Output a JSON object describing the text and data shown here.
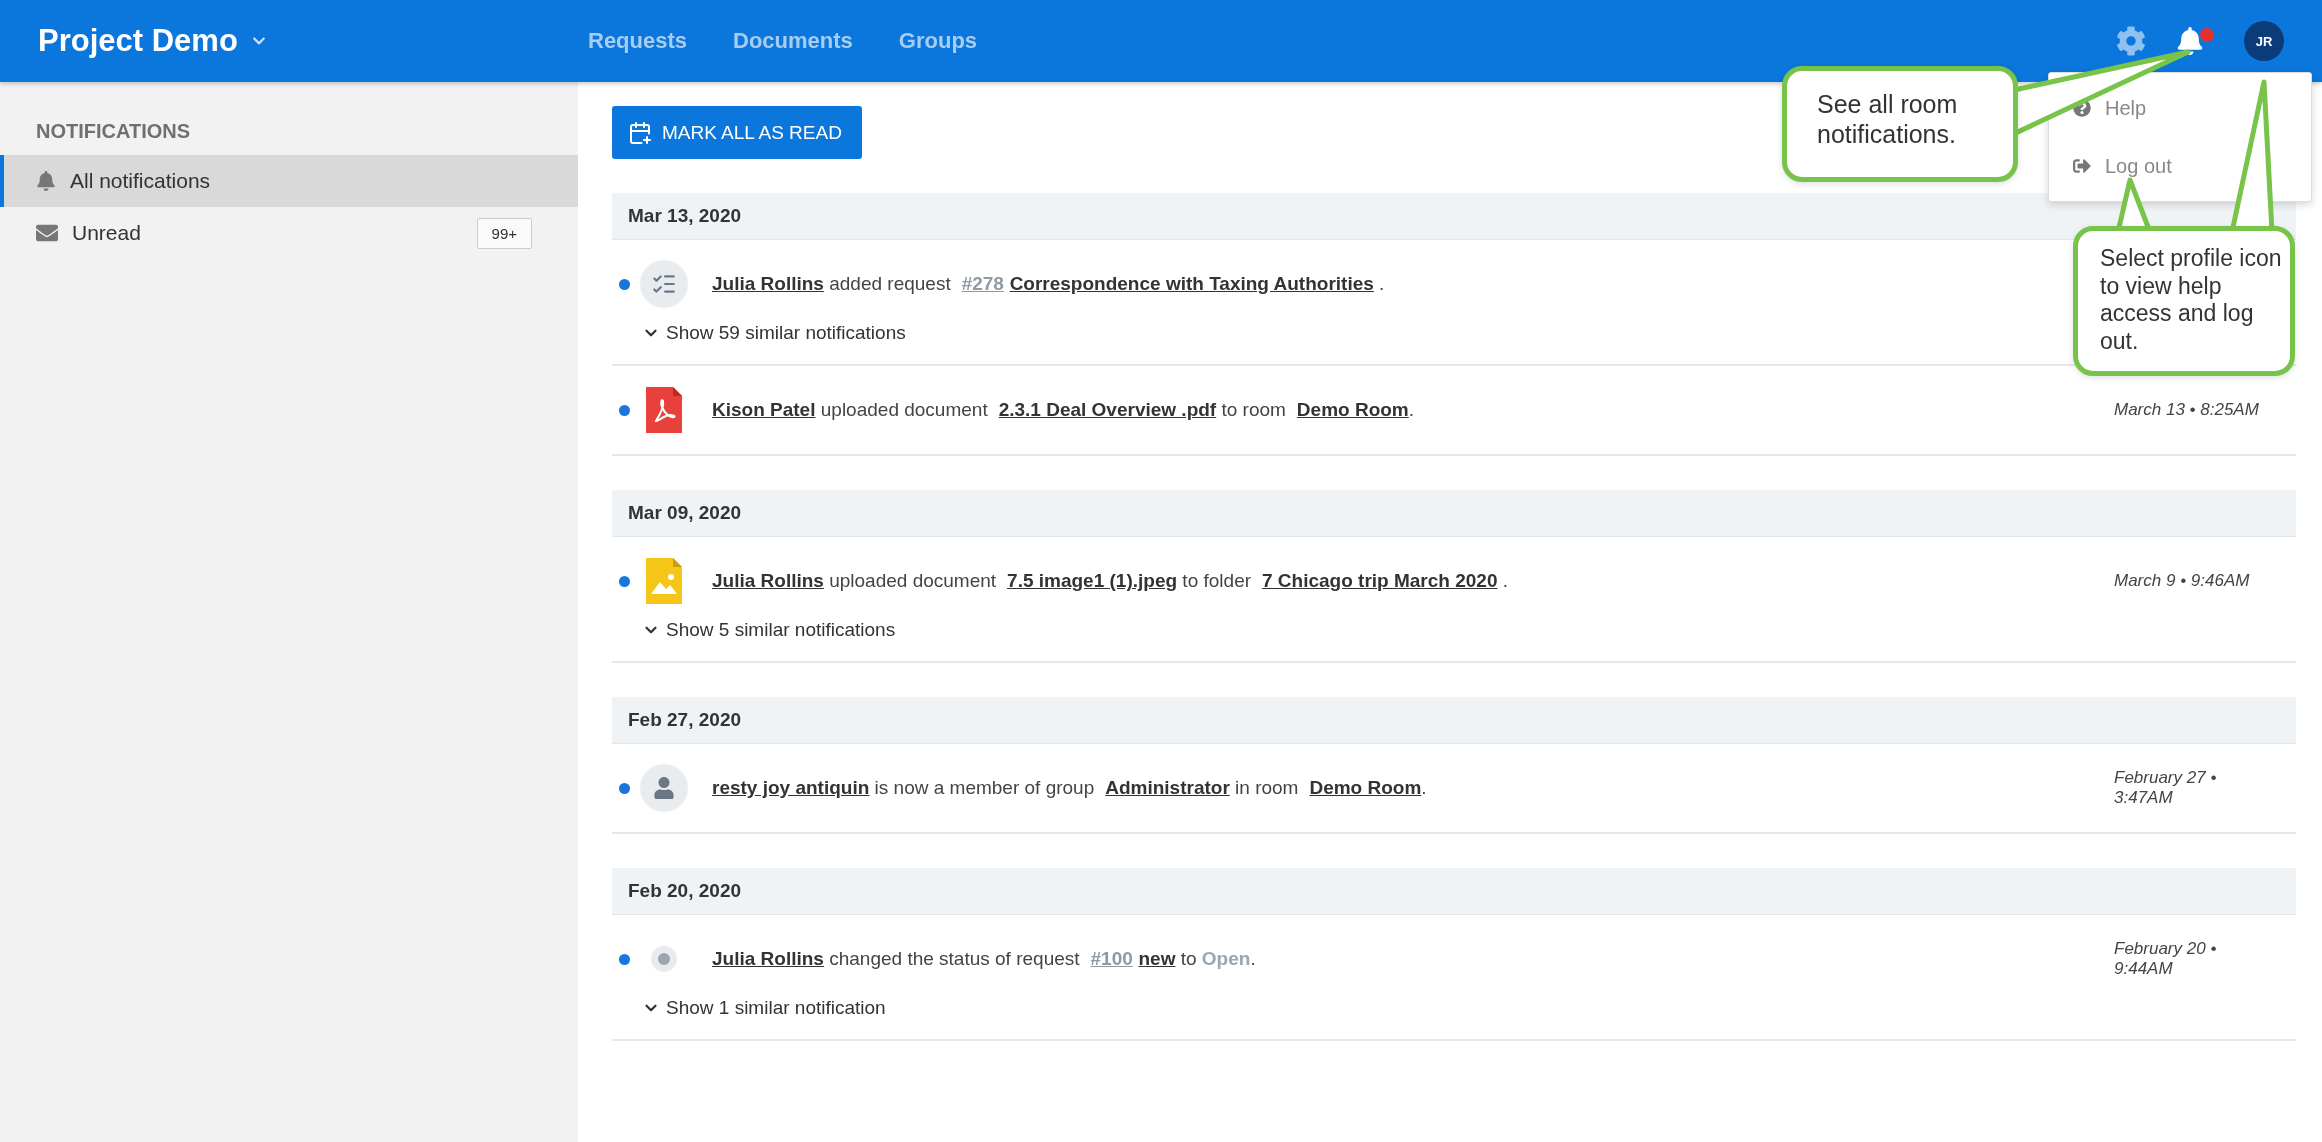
{
  "header": {
    "title": "Project Demo",
    "nav": [
      {
        "label": "Requests",
        "selected": false
      },
      {
        "label": "Documents",
        "selected": false
      },
      {
        "label": "Groups",
        "selected": false
      }
    ],
    "bell_alert": true,
    "avatar": "JR"
  },
  "profile_menu": {
    "items": [
      {
        "kind": "help",
        "label": "Help"
      },
      {
        "kind": "logout",
        "label": "Log out"
      }
    ]
  },
  "sidebar": {
    "heading": "NOTIFICATIONS",
    "items": [
      {
        "kind": "bell",
        "label": "All notifications",
        "selected": true
      },
      {
        "kind": "mail",
        "label": "Unread",
        "selected": false,
        "badge": "99+"
      }
    ]
  },
  "mark_all_button": "MARK ALL AS READ",
  "groups": [
    {
      "date": "Mar 13, 2020",
      "items": [
        {
          "kind": "checklist",
          "unread": true,
          "parts": [
            {
              "kind": "link",
              "text": "Julia Rollins"
            },
            {
              "kind": "text",
              "text": " added request "
            },
            {
              "kind": "ref",
              "text": "#278"
            },
            {
              "kind": "link",
              "text": "Correspondence with Taxing Authorities"
            },
            {
              "kind": "text",
              "text": " ."
            }
          ],
          "similar": "Show 59 similar notifications"
        },
        {
          "kind": "pdf",
          "unread": true,
          "parts": [
            {
              "kind": "link",
              "text": "Kison Patel"
            },
            {
              "kind": "text",
              "text": " uploaded document "
            },
            {
              "kind": "link",
              "text": "2.3.1 Deal Overview .pdf"
            },
            {
              "kind": "text",
              "text": " to room "
            },
            {
              "kind": "link",
              "text": "Demo Room"
            },
            {
              "kind": "text",
              "text": "."
            }
          ],
          "time": "March 13 • 8:25AM"
        }
      ]
    },
    {
      "date": "Mar 09, 2020",
      "items": [
        {
          "kind": "image",
          "unread": true,
          "parts": [
            {
              "kind": "link",
              "text": "Julia Rollins"
            },
            {
              "kind": "text",
              "text": " uploaded document "
            },
            {
              "kind": "link",
              "text": "7.5 image1 (1).jpeg"
            },
            {
              "kind": "text",
              "text": " to folder "
            },
            {
              "kind": "link",
              "text": "7 Chicago trip March 2020"
            },
            {
              "kind": "text",
              "text": " ."
            }
          ],
          "time": "March 9 • 9:46AM",
          "similar": "Show 5 similar notifications"
        }
      ]
    },
    {
      "date": "Feb 27, 2020",
      "items": [
        {
          "kind": "person",
          "unread": true,
          "parts": [
            {
              "kind": "link",
              "text": "resty joy antiquin"
            },
            {
              "kind": "text",
              "text": " is now a member of group "
            },
            {
              "kind": "link",
              "text": "Administrator"
            },
            {
              "kind": "text",
              "text": " in room "
            },
            {
              "kind": "link",
              "text": "Demo Room"
            },
            {
              "kind": "text",
              "text": "."
            }
          ],
          "time": "February 27 • 3:47AM"
        }
      ]
    },
    {
      "date": "Feb 20, 2020",
      "items": [
        {
          "kind": "status",
          "unread": true,
          "parts": [
            {
              "kind": "link",
              "text": "Julia Rollins"
            },
            {
              "kind": "text",
              "text": " changed the status of request "
            },
            {
              "kind": "ref",
              "text": "#100"
            },
            {
              "kind": "link",
              "text": "new"
            },
            {
              "kind": "text",
              "text": " to "
            },
            {
              "kind": "status",
              "text": "Open"
            },
            {
              "kind": "text",
              "text": "."
            }
          ],
          "time": "February 20 • 9:44AM",
          "similar": "Show 1 similar notification"
        }
      ]
    }
  ],
  "callouts": [
    {
      "text": "See all room notifications."
    },
    {
      "text": "Select profile icon to view help access and log out."
    }
  ]
}
